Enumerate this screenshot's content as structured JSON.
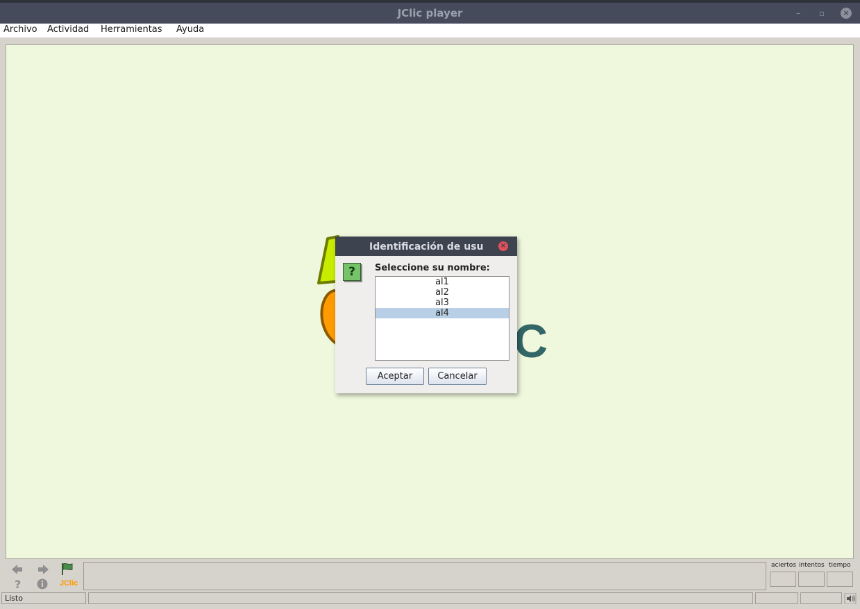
{
  "window": {
    "title": "JClic player",
    "minimize_glyph": "–",
    "maximize_glyph": "▫",
    "close_glyph": "×"
  },
  "menu": {
    "items": [
      {
        "label": "Archivo"
      },
      {
        "label": "Actividad"
      },
      {
        "label": "Herramientas"
      },
      {
        "label": "Ayuda"
      }
    ]
  },
  "colors": {
    "play_area_bg": "#eff7dc",
    "logo_green": "#c8ec00",
    "logo_orange": "#ff9a00",
    "logo_teal": "#336666",
    "selection": "#b9cfe6"
  },
  "logo": {
    "visible_letter": "C"
  },
  "dialog": {
    "title": "Identificación de usu",
    "close_glyph": "×",
    "icon_glyph": "?",
    "prompt": "Seleccione su nombre:",
    "users": [
      "al1",
      "al2",
      "al3",
      "al4"
    ],
    "selected_user": "al4",
    "accept_label": "Aceptar",
    "cancel_label": "Cancelar"
  },
  "controls": {
    "icons": [
      "arrow-left-icon",
      "arrow-right-icon",
      "flag-icon",
      "help-icon",
      "info-icon",
      "jclic-logo-icon"
    ],
    "jclic_label": "JClic",
    "counters": {
      "score_label": "aciertos",
      "attempts_label": "intentos",
      "time_label": "tiempo"
    }
  },
  "status": {
    "text": "Listo"
  }
}
